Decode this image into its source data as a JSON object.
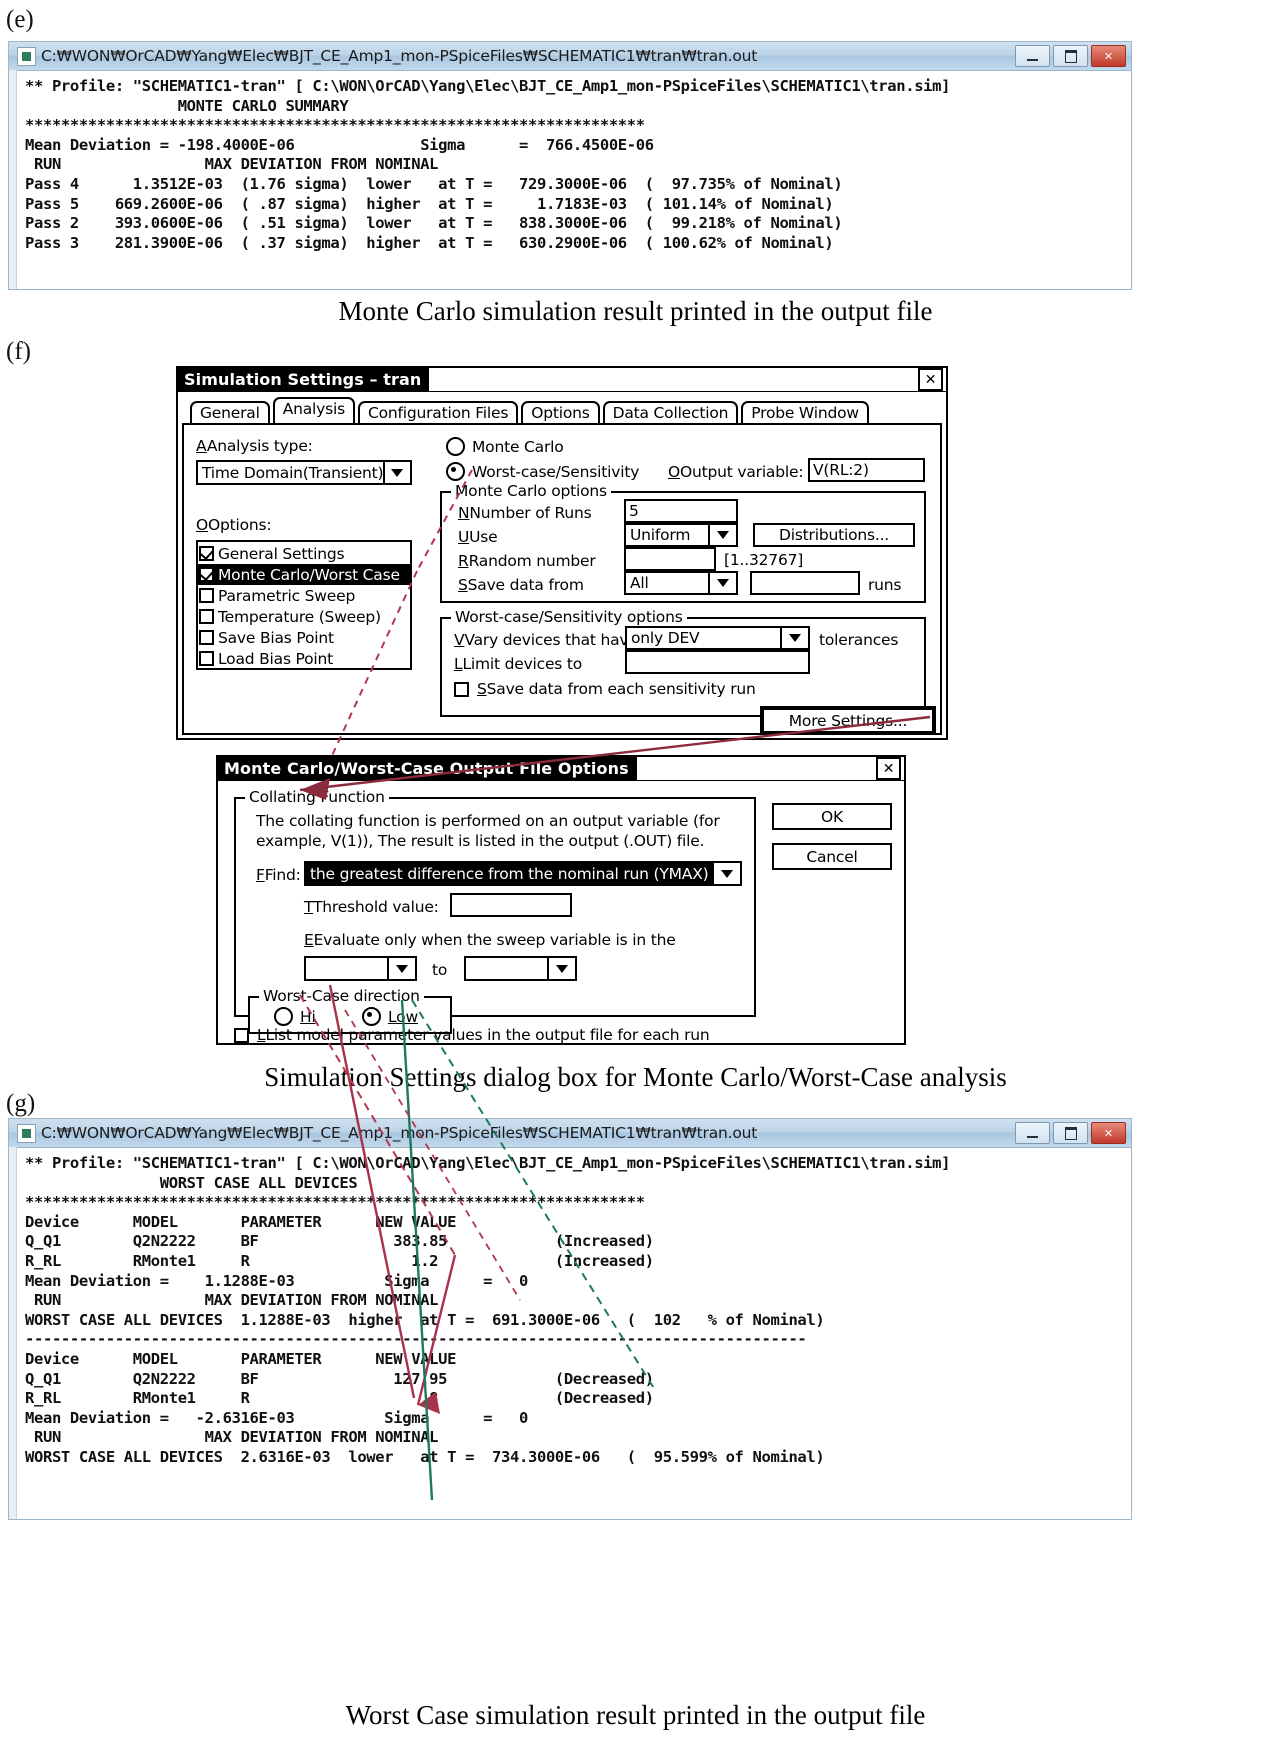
{
  "figures": {
    "e_label": "(e)",
    "f_label": "(f)",
    "g_label": "(g)",
    "e_caption": "Monte Carlo simulation result printed in the output file",
    "f_caption": "Simulation Settings dialog box for Monte Carlo/Worst-Case analysis",
    "g_caption": "Worst Case simulation result printed in the output file"
  },
  "window_e": {
    "title": "C:₩WON₩OrCAD₩Yang₩Elec₩BJT_CE_Amp1_mon-PSpiceFiles₩SCHEMATIC1₩tran₩tran.out",
    "buttons": {
      "minimize": "–",
      "maximize": "□",
      "close": "✕"
    },
    "lines": [
      "** Profile: \"SCHEMATIC1-tran\" [ C:\\WON\\OrCAD\\Yang\\Elec\\BJT_CE_Amp1_mon-PSpiceFiles\\SCHEMATIC1\\tran.sim]",
      "                 MONTE CARLO SUMMARY",
      "*********************************************************************",
      "Mean Deviation = -198.4000E-06              Sigma      =  766.4500E-06",
      " RUN                MAX DEVIATION FROM NOMINAL",
      "Pass 4      1.3512E-03  (1.76 sigma)  lower   at T =   729.3000E-06  (  97.735% of Nominal)",
      "Pass 5    669.2600E-06  ( .87 sigma)  higher  at T =     1.7183E-03  ( 101.14% of Nominal)",
      "Pass 2    393.0600E-06  ( .51 sigma)  lower   at T =   838.3000E-06  (  99.218% of Nominal)",
      "Pass 3    281.3900E-06  ( .37 sigma)  higher  at T =   630.2900E-06  ( 100.62% of Nominal)"
    ]
  },
  "sim_settings": {
    "title": "Simulation Settings – tran",
    "close_label": "✕",
    "tabs": [
      {
        "label": "General",
        "active": false
      },
      {
        "label": "Analysis",
        "active": true
      },
      {
        "label": "Configuration Files",
        "active": false
      },
      {
        "label": "Options",
        "active": false
      },
      {
        "label": "Data Collection",
        "active": false
      },
      {
        "label": "Probe Window",
        "active": false
      }
    ],
    "analysis_type_label": "Analysis type:",
    "analysis_type_value": "Time Domain(Transient)",
    "options_label": "Options:",
    "option_items": [
      {
        "label": "General Settings",
        "checked": true,
        "selected": false
      },
      {
        "label": "Monte Carlo/Worst Case",
        "checked": true,
        "selected": true
      },
      {
        "label": "Parametric Sweep",
        "checked": false,
        "selected": false
      },
      {
        "label": "Temperature (Sweep)",
        "checked": false,
        "selected": false
      },
      {
        "label": "Save Bias Point",
        "checked": false,
        "selected": false
      },
      {
        "label": "Load Bias Point",
        "checked": false,
        "selected": false
      }
    ],
    "radio_monte_carlo": "Monte Carlo",
    "radio_worst_case": "Worst-case/Sensitivity",
    "radio_selected": "Worst-case/Sensitivity",
    "output_variable_label": "Output variable:",
    "output_variable_value": "V(RL:2)",
    "mc_group_label": "Monte Carlo options",
    "mc_number_of_runs_label": "Number of Runs",
    "mc_number_of_runs_value": "5",
    "mc_use_label": "Use",
    "mc_use_value": "Uniform",
    "mc_distributions_button": "Distributions...",
    "mc_random_number_label": "Random number",
    "mc_random_number_value": "",
    "mc_random_number_hint": "[1..32767]",
    "mc_save_data_from_label": "Save data from",
    "mc_save_data_from_value": "All",
    "mc_save_data_runs_value": "",
    "mc_runs_suffix": "runs",
    "wc_group_label": "Worst-case/Sensitivity options",
    "wc_vary_label": "Vary devices that have",
    "wc_vary_value": "only DEV",
    "wc_tolerances_suffix": "tolerances",
    "wc_limit_label": "Limit devices to",
    "wc_limit_value": "",
    "wc_save_each_label": "Save data from each sensitivity run",
    "wc_save_each_checked": false,
    "more_settings_button": "More Settings..."
  },
  "output_file_options": {
    "title": "Monte Carlo/Worst-Case Output File Options",
    "close_label": "✕",
    "collating_group_label": "Collating Function",
    "collating_text_line1": "The collating function is performed on an output variable (for",
    "collating_text_line2": "example,  V(1)),  The result is listed in the output (.OUT) file.",
    "find_label": "Find:",
    "find_value": "the greatest difference from the nominal run (YMAX)",
    "threshold_label": "Threshold value:",
    "threshold_value": "",
    "evaluate_label": "Evaluate only when the sweep variable is in the",
    "range_from_value": "",
    "range_to_label": "to",
    "range_to_value": "",
    "direction_group_label": "Worst-Case direction",
    "direction_hi": "Hi",
    "direction_low": "Low",
    "direction_selected": "Low",
    "list_model_label": "List model parameter values in the output file for each run",
    "list_model_checked": false,
    "ok_button": "OK",
    "cancel_button": "Cancel"
  },
  "window_g": {
    "title": "C:₩WON₩OrCAD₩Yang₩Elec₩BJT_CE_Amp1_mon-PSpiceFiles₩SCHEMATIC1₩tran₩tran.out",
    "buttons": {
      "minimize": "–",
      "maximize": "□",
      "close": "✕"
    },
    "lines": [
      "** Profile: \"SCHEMATIC1-tran\" [ C:\\WON\\OrCAD\\Yang\\Elec\\BJT_CE_Amp1_mon-PSpiceFiles\\SCHEMATIC1\\tran.sim]",
      "               WORST CASE ALL DEVICES",
      "*********************************************************************",
      "Device      MODEL       PARAMETER      NEW VALUE",
      "Q_Q1        Q2N2222     BF               383.85            (Increased)",
      "R_RL        RMonte1     R                  1.2             (Increased)",
      "Mean Deviation =    1.1288E-03          Sigma      =   0",
      " RUN                MAX DEVIATION FROM NOMINAL",
      "WORST CASE ALL DEVICES  1.1288E-03  higher  at T =  691.3000E-06   (  102   % of Nominal)",
      "---------------------------------------------------------------------------------------",
      "Device      MODEL       PARAMETER      NEW VALUE",
      "Q_Q1        Q2N2222     BF               127.95            (Decreased)",
      "R_RL        RMonte1     R                   .8             (Decreased)",
      "Mean Deviation =   -2.6316E-03          Sigma      =   0",
      " RUN                MAX DEVIATION FROM NOMINAL",
      "WORST CASE ALL DEVICES  2.6316E-03  lower   at T =  734.3000E-06   (  95.599% of Nominal)"
    ]
  },
  "colors": {
    "titlebar_blue": "#bcd4e8",
    "close_red": "#c0392b",
    "leader_red": "#b3364a",
    "leader_green": "#1f7a5c",
    "dialog_black": "#000000"
  }
}
